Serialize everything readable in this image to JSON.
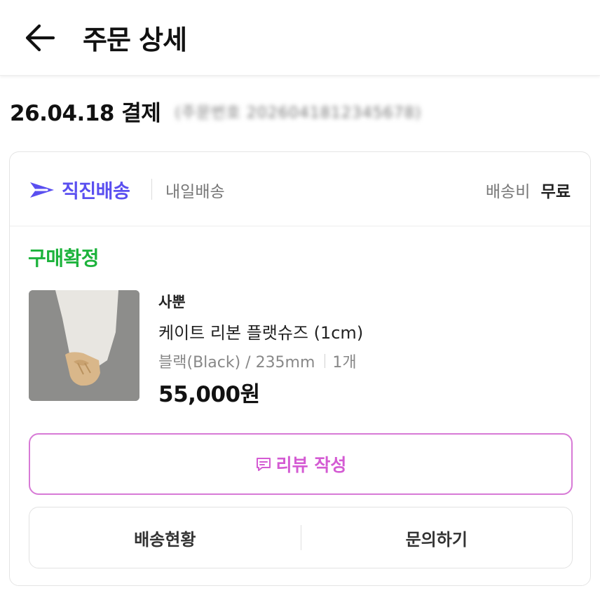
{
  "header": {
    "title": "주문 상세",
    "back_icon": "arrow-left-icon"
  },
  "order": {
    "date_label": "26.04.18 결제",
    "order_number_blurred": "(주문번호 2026041812345678)"
  },
  "shipping": {
    "brand": "직진배송",
    "type": "내일배송",
    "fee_label": "배송비",
    "fee_value": "무료",
    "brand_color": "#5a4ff0"
  },
  "item": {
    "status": "구매확정",
    "status_color": "#1db33c",
    "seller": "사뿐",
    "product_name": "케이트 리본 플랫슈즈 (1cm)",
    "option": "블랙(Black) / 235mm",
    "quantity": "1개",
    "price": "55,000원"
  },
  "actions": {
    "review_label": "리뷰 작성",
    "review_color": "#d45bd3",
    "tracking_label": "배송현황",
    "inquiry_label": "문의하기"
  }
}
